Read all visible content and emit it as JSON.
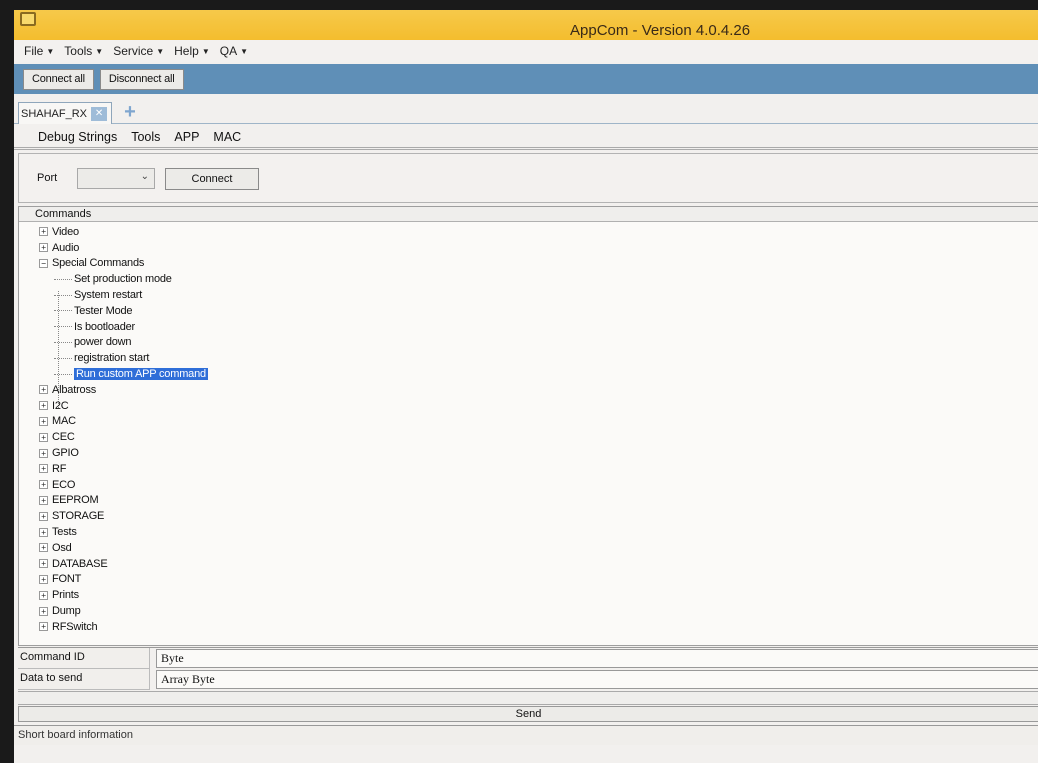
{
  "window": {
    "title": "AppCom - Version 4.0.4.26"
  },
  "menu": [
    {
      "label": "File"
    },
    {
      "label": "Tools"
    },
    {
      "label": "Service"
    },
    {
      "label": "Help"
    },
    {
      "label": "QA"
    }
  ],
  "connection_toolbar": {
    "connect_all": "Connect all",
    "disconnect_all": "Disconnect all"
  },
  "device_tabs": [
    {
      "label": "SHAHAF_RX",
      "close_icon": "close-icon"
    }
  ],
  "add_tab_icon": "plus-icon",
  "sub_tabs": [
    "Debug Strings",
    "Tools",
    "APP",
    "MAC"
  ],
  "port": {
    "label": "Port",
    "selected": "",
    "connect_label": "Connect"
  },
  "commands": {
    "header": "Commands",
    "tree": [
      {
        "label": "Video",
        "expanded": false
      },
      {
        "label": "Audio",
        "expanded": false
      },
      {
        "label": "Special Commands",
        "expanded": true,
        "children": [
          {
            "label": "Set production mode"
          },
          {
            "label": "System restart"
          },
          {
            "label": "Tester Mode"
          },
          {
            "label": "Is bootloader"
          },
          {
            "label": "power down"
          },
          {
            "label": "registration start"
          },
          {
            "label": "Run custom APP command",
            "selected": true
          }
        ]
      },
      {
        "label": "Albatross",
        "expanded": false
      },
      {
        "label": "I2C",
        "expanded": false
      },
      {
        "label": "MAC",
        "expanded": false
      },
      {
        "label": "CEC",
        "expanded": false
      },
      {
        "label": "GPIO",
        "expanded": false
      },
      {
        "label": "RF",
        "expanded": false
      },
      {
        "label": "ECO",
        "expanded": false
      },
      {
        "label": "EEPROM",
        "expanded": false
      },
      {
        "label": "STORAGE",
        "expanded": false
      },
      {
        "label": "Tests",
        "expanded": false
      },
      {
        "label": "Osd",
        "expanded": false
      },
      {
        "label": "DATABASE",
        "expanded": false
      },
      {
        "label": "FONT",
        "expanded": false
      },
      {
        "label": "Prints",
        "expanded": false
      },
      {
        "label": "Dump",
        "expanded": false
      },
      {
        "label": "RFSwitch",
        "expanded": false
      }
    ]
  },
  "form": {
    "command_id": {
      "label": "Command ID",
      "value": "Byte"
    },
    "data_to_send": {
      "label": "Data to send",
      "value": "Array Byte"
    }
  },
  "send_label": "Send",
  "status": "Short board information",
  "colors": {
    "titlebar": "#f4bd2e",
    "toolbar": "#5f8fb7",
    "selection": "#2f6ed8"
  }
}
